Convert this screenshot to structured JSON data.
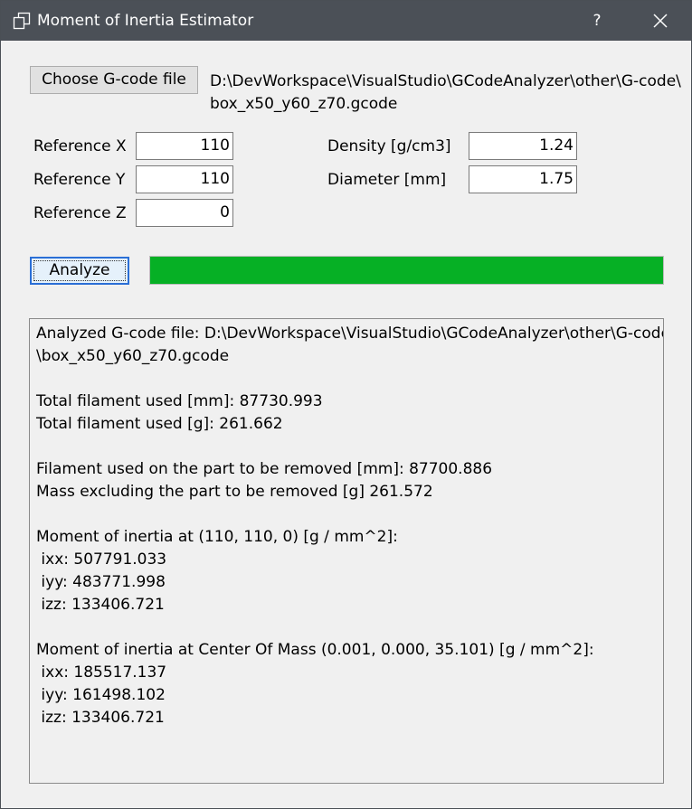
{
  "window": {
    "title": "Moment of Inertia Estimator",
    "help_label": "?",
    "icon": "window-restore-icon",
    "close_icon": "close-icon"
  },
  "file": {
    "button_label": "Choose G-code file",
    "path_line1": "D:\\DevWorkspace\\VisualStudio\\GCodeAnalyzer\\other\\G-code\\",
    "path_line2": "box_x50_y60_z70.gcode"
  },
  "inputs": {
    "ref_x": {
      "label": "Reference X",
      "value": "110"
    },
    "ref_y": {
      "label": "Reference Y",
      "value": "110"
    },
    "ref_z": {
      "label": "Reference Z",
      "value": "0"
    },
    "density": {
      "label": "Density [g/cm3]",
      "value": "1.24"
    },
    "diameter": {
      "label": "Diameter [mm]",
      "value": "1.75"
    }
  },
  "analyze": {
    "button_label": "Analyze",
    "progress": 1.0,
    "progress_color": "#06b025"
  },
  "results": {
    "lines": [
      "Analyzed G-code file: D:\\DevWorkspace\\VisualStudio\\GCodeAnalyzer\\other\\G-code",
      "\\box_x50_y60_z70.gcode",
      "",
      "Total filament used [mm]: 87730.993",
      "Total filament used [g]: 261.662",
      "",
      "Filament used on the part to be removed [mm]: 87700.886",
      "Mass excluding the part to be removed [g] 261.572",
      "",
      "Moment of inertia at (110, 110, 0) [g / mm^2]:",
      " ixx: 507791.033",
      " iyy: 483771.998",
      " izz: 133406.721",
      "",
      "Moment of inertia at Center Of Mass (0.001, 0.000, 35.101) [g / mm^2]:",
      " ixx: 185517.137",
      " iyy: 161498.102",
      " izz: 133406.721"
    ]
  }
}
